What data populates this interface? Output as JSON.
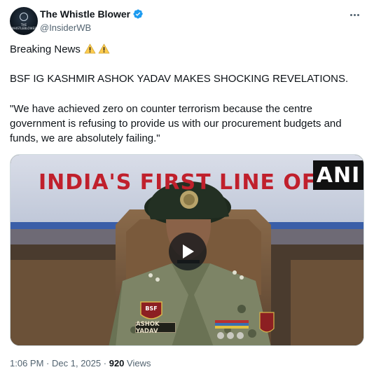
{
  "author": {
    "display_name": "The Whistle Blower",
    "handle": "@InsiderWB",
    "avatar_text": "THE WHISTLEBLOWER",
    "verified": true,
    "verified_color": "#1d9bf0"
  },
  "tweet": {
    "line1": "Breaking News",
    "line1_emoji": [
      "warning-icon",
      "warning-icon"
    ],
    "line2": "BSF IG KASHMIR ASHOK YADAV MAKES SHOCKING REVELATIONS.",
    "line3": "\"We have achieved zero on counter terrorism because the centre government is refusing to provide us with our procurement budgets and funds, we are absolutely failing.\""
  },
  "media": {
    "type": "video",
    "banner_text": "INDIA'S FIRST LINE OF D",
    "watermark": "ANI",
    "nameplate": "ASHOK YADAV",
    "badge_text": "BSF",
    "play_icon": "play-icon"
  },
  "meta": {
    "time": "1:06 PM",
    "separator": "·",
    "date": "Dec 1, 2025",
    "views_count": "920",
    "views_label": "Views"
  },
  "colors": {
    "text_primary": "#0f1419",
    "text_secondary": "#536471",
    "border": "#cfd9de",
    "banner_red": "#c0202c",
    "banner_blue": "#3a5ea8"
  }
}
